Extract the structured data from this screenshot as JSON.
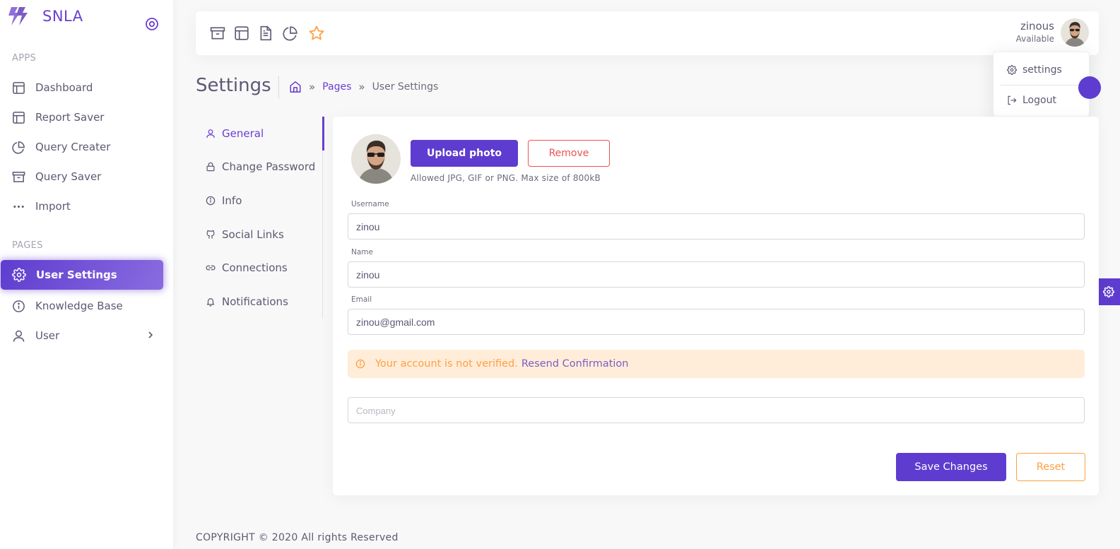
{
  "brand": {
    "name": "SNLA"
  },
  "sidebar": {
    "sections": [
      {
        "label": "APPS"
      },
      {
        "label": "PAGES"
      }
    ],
    "items": [
      {
        "label": "Dashboard",
        "icon": "layout-icon"
      },
      {
        "label": "Report Saver",
        "icon": "layout-icon"
      },
      {
        "label": "Query Creater",
        "icon": "pie-chart-icon"
      },
      {
        "label": "Query Saver",
        "icon": "archive-icon"
      },
      {
        "label": "Import",
        "icon": "more-horizontal-icon"
      },
      {
        "label": "User Settings",
        "icon": "gear-icon",
        "active": true
      },
      {
        "label": "Knowledge Base",
        "icon": "info-icon"
      },
      {
        "label": "User",
        "icon": "user-icon"
      }
    ]
  },
  "topbar": {
    "shortcuts": [
      "archive-icon",
      "layout-icon",
      "file-text-icon",
      "pie-chart-icon",
      "star-icon"
    ],
    "user": {
      "name": "zinous",
      "status": "Available"
    }
  },
  "user_menu": {
    "items": [
      {
        "label": "settings",
        "icon": "gear-icon"
      },
      {
        "label": "Logout",
        "icon": "logout-icon"
      }
    ]
  },
  "page": {
    "title": "Settings",
    "breadcrumb": {
      "home_icon": "home-icon",
      "pages": "Pages",
      "current": "User Settings"
    }
  },
  "settings_nav": {
    "items": [
      {
        "label": "General",
        "icon": "user-icon",
        "active": true
      },
      {
        "label": "Change Password",
        "icon": "lock-icon"
      },
      {
        "label": "Info",
        "icon": "info-icon"
      },
      {
        "label": "Social Links",
        "icon": "github-icon"
      },
      {
        "label": "Connections",
        "icon": "link-icon"
      },
      {
        "label": "Notifications",
        "icon": "bell-icon"
      }
    ]
  },
  "general": {
    "upload_label": "Upload photo",
    "remove_label": "Remove",
    "upload_hint": "Allowed JPG, GIF or PNG. Max size of 800kB",
    "fields": {
      "username": {
        "label": "Username",
        "value": "zinou"
      },
      "name": {
        "label": "Name",
        "value": "zinou"
      },
      "email": {
        "label": "Email",
        "value": "zinou@gmail.com"
      },
      "company": {
        "placeholder": "Company",
        "value": ""
      }
    },
    "alert": {
      "text": "Your account is not verified.",
      "link": "Resend Confirmation"
    },
    "save_label": "Save Changes",
    "reset_label": "Reset"
  },
  "footer": {
    "text": "COPYRIGHT © 2020 All rights Reserved"
  },
  "colors": {
    "primary": "#5e3ccf",
    "warning": "#ff9f43",
    "danger": "#ea5455",
    "text": "#5e5873"
  }
}
